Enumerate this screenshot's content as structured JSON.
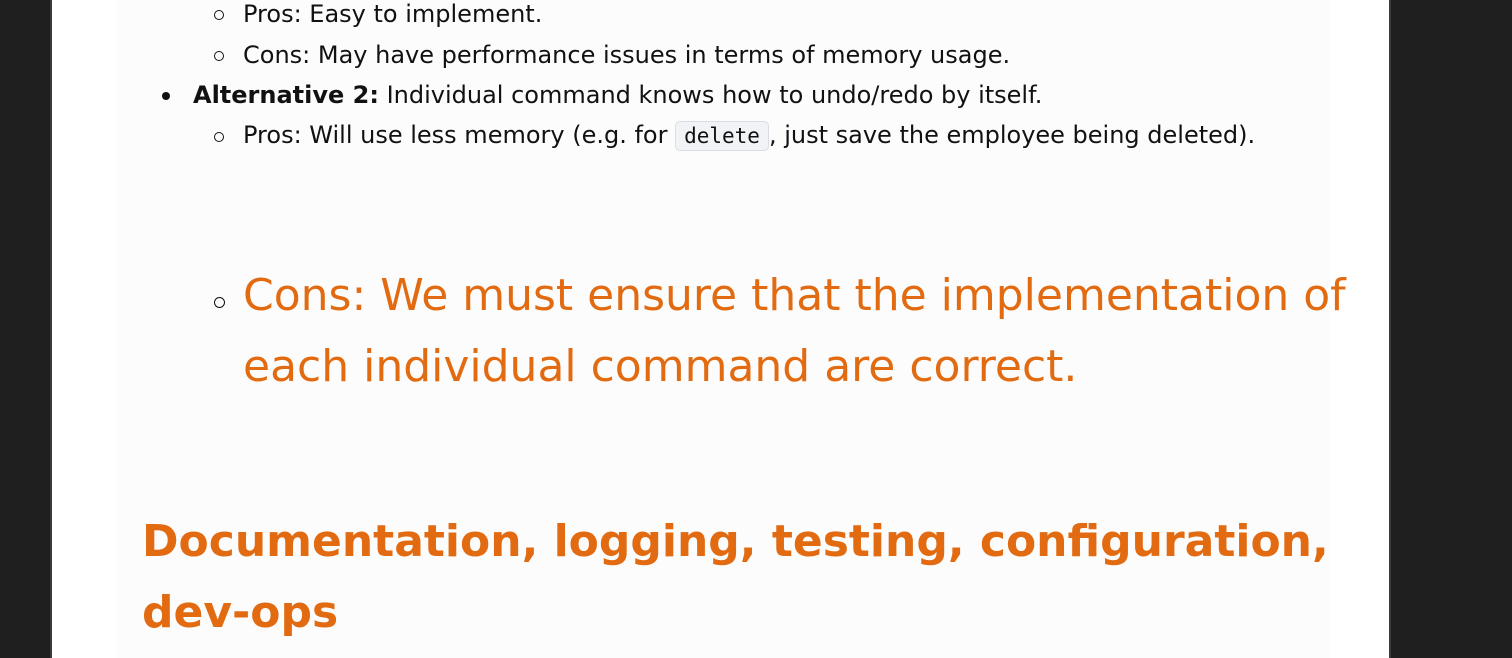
{
  "alt1": {
    "pros": "Pros: Easy to implement.",
    "cons": "Cons: May have performance issues in terms of memory usage."
  },
  "alt2": {
    "label": "Alternative 2:",
    "text": " Individual command knows how to undo/redo by itself.",
    "pros_prefix": "Pros: Will use less memory (e.g. for ",
    "pros_code": "delete",
    "pros_suffix": ", just save the employee being deleted).",
    "cons_line1": "Cons: We must ensure that the implementation of",
    "cons_line2": "each individual command are correct."
  },
  "section_heading_line1": "Documentation, logging, testing, configuration,",
  "section_heading_line2": "dev-ops",
  "colors": {
    "accent": "#e26b12",
    "background": "#1f1f1f",
    "page": "#fcfcfc"
  }
}
